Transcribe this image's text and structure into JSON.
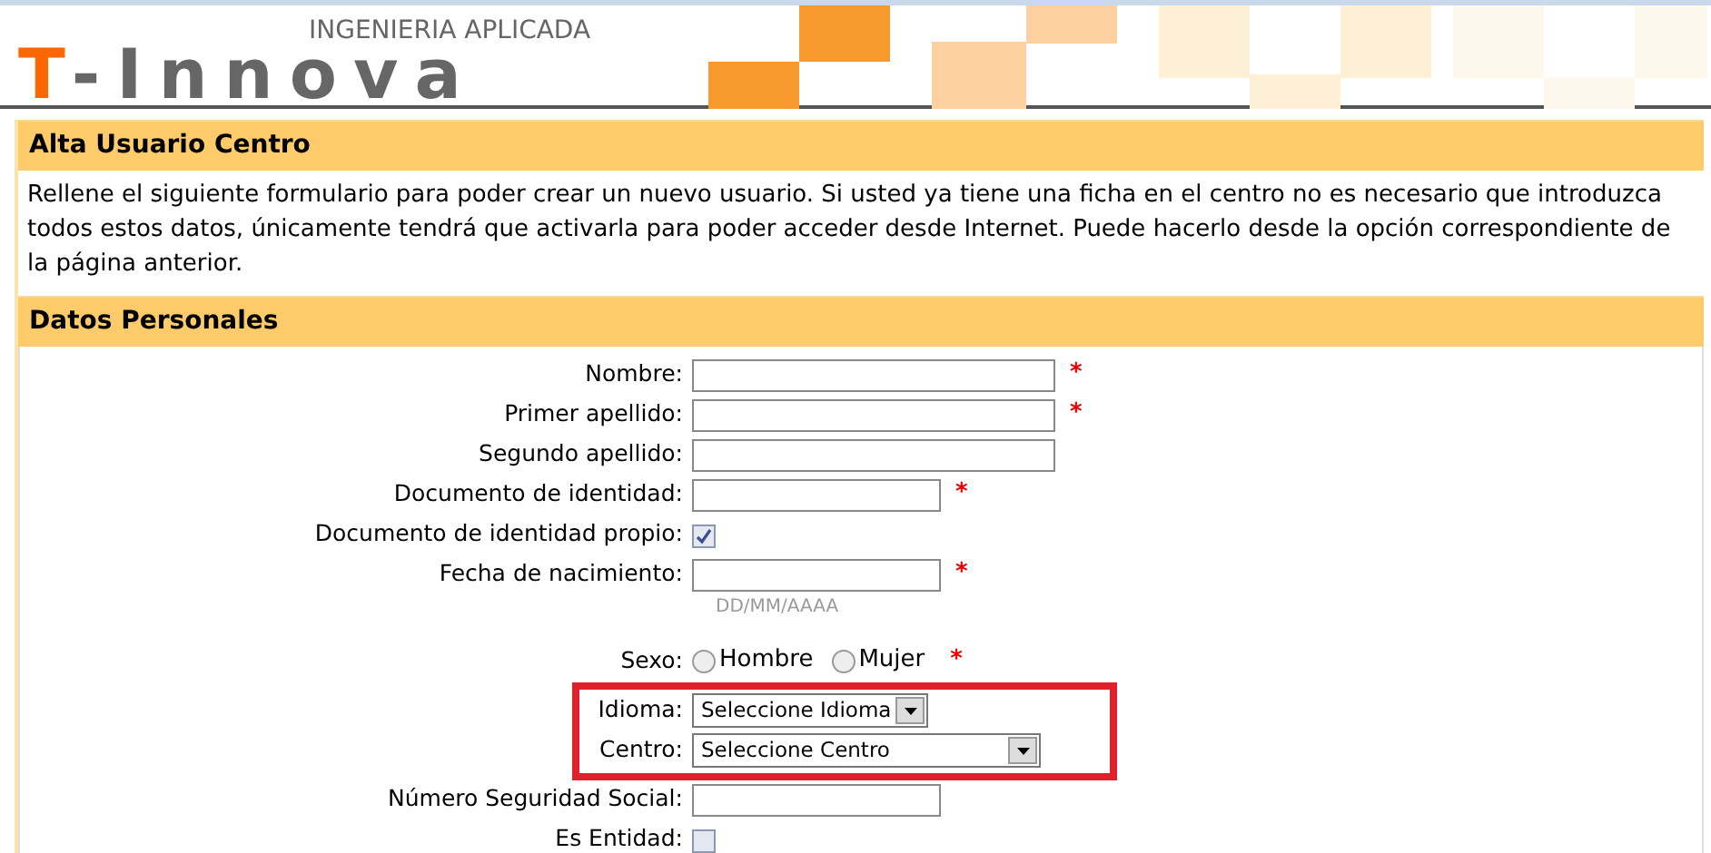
{
  "logo": {
    "initial": "T",
    "rest": "-Innova",
    "tagline": "INGENIERIA APLICADA"
  },
  "intro": {
    "title": "Alta Usuario Centro",
    "text": "Rellene el siguiente formulario para poder crear un nuevo usuario. Si usted ya tiene una ficha en el centro no es necesario que introduzca todos estos datos, únicamente tendrá que activarla para poder acceder desde Internet. Puede hacerlo desde la opción correspondiente de la página anterior."
  },
  "form": {
    "title": "Datos Personales",
    "fields": [
      {
        "kind": "text",
        "label": "Nombre:",
        "required_mark": "*",
        "highlighted": false
      },
      {
        "kind": "text",
        "label": "Primer apellido:",
        "required_mark": "*",
        "highlighted": false
      },
      {
        "kind": "text",
        "label": "Segundo apellido:",
        "highlighted": false
      },
      {
        "kind": "short-text",
        "label": "Documento de identidad:",
        "required_mark": "*",
        "highlighted": false
      },
      {
        "kind": "checkbox",
        "label": "Documento de identidad propio:",
        "checked": true,
        "highlighted": false
      },
      {
        "kind": "short-text",
        "label": "Fecha de nacimiento:",
        "hint": "DD/MM/AAAA",
        "required_mark": "*",
        "highlighted": false
      },
      {
        "kind": "radio",
        "label": "Sexo:",
        "options": [
          {
            "label": "Hombre",
            "selected": false
          },
          {
            "label": "Mujer",
            "selected": false
          }
        ],
        "required_mark": "*",
        "highlighted": false
      },
      {
        "kind": "short-select",
        "label": "Idioma:",
        "value": "Seleccione Idioma",
        "highlighted": true
      },
      {
        "kind": "select",
        "label": "Centro:",
        "value": "Seleccione Centro",
        "highlighted": true
      },
      {
        "kind": "short-text",
        "label": "Número Seguridad Social:",
        "highlighted": false
      },
      {
        "kind": "checkbox",
        "label": "Es Entidad:",
        "checked": false,
        "highlighted": false
      }
    ]
  }
}
